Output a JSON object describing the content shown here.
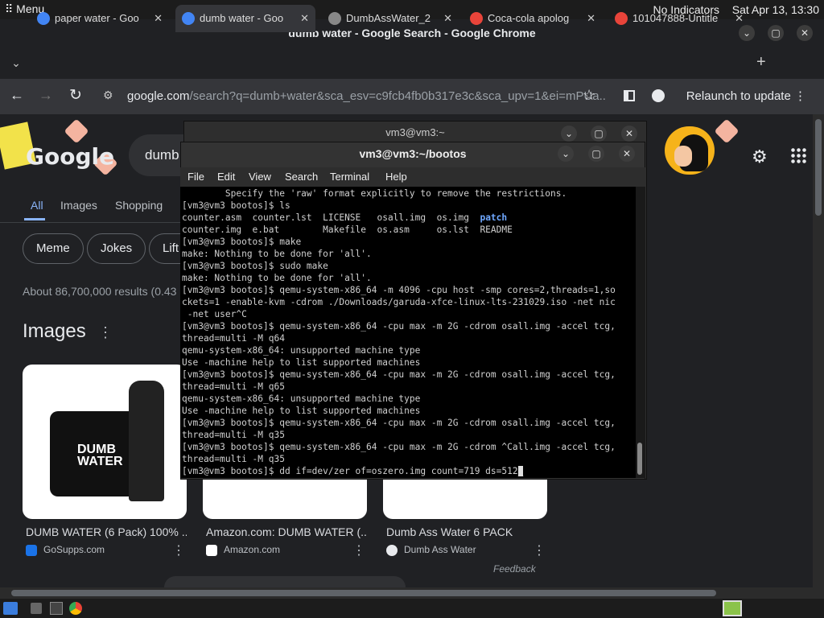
{
  "sysbar": {
    "menu": "Menu",
    "indicators": "No Indicators",
    "clock": "Sat Apr 13, 13:30"
  },
  "window": {
    "title": "dumb water - Google Search - Google Chrome",
    "minimize": "⌄",
    "maximize": "▢",
    "close": "✕"
  },
  "tabs": [
    {
      "label": "paper water - Goo",
      "close": "✕",
      "favicon_color": "#4285f4"
    },
    {
      "label": "dumb water - Goo",
      "close": "✕",
      "favicon_color": "#4285f4"
    },
    {
      "label": "DumbAssWater_2",
      "close": "✕",
      "favicon_color": "#888888"
    },
    {
      "label": "Coca-cola apolog",
      "close": "✕",
      "favicon_color": "#e8443a"
    },
    {
      "label": "101047888-Untitle",
      "close": "✕",
      "favicon_color": "#e8443a"
    }
  ],
  "new_tab": "+",
  "toolbar": {
    "back": "←",
    "forward": "→",
    "reload": "↻",
    "url_host": "google.com",
    "url_rest": "/search?q=dumb+water&sca_esv=c9fcb4fb0b317e3c&sca_upv=1&ei=mPUa...",
    "star": "☆",
    "relaunch": "Relaunch to update",
    "menu": "⋮"
  },
  "google": {
    "logo": "Google",
    "search_text": "dumb",
    "nav": [
      {
        "label": "All"
      },
      {
        "label": "Images"
      },
      {
        "label": "Shopping"
      }
    ],
    "chips": [
      {
        "label": "Meme"
      },
      {
        "label": "Jokes"
      },
      {
        "label": "Lift"
      }
    ],
    "results_count": "About 86,700,000 results (0.43",
    "images_heading": "Images",
    "images": [
      {
        "caption": "DUMB WATER (6 Pack) 100% ...",
        "source": "GoSupps.com",
        "product_text": "DUMB WATER"
      },
      {
        "caption": "Amazon.com: DUMB WATER (...",
        "source": "Amazon.com"
      },
      {
        "caption": "Dumb Ass Water 6 PACK",
        "source": "Dumb Ass Water"
      }
    ],
    "feedback": "Feedback",
    "more_menu": "⋮"
  },
  "terminal_outer": {
    "title": "vm3@vm3:~"
  },
  "terminal": {
    "title": "vm3@vm3:~/bootos",
    "menu": [
      {
        "label": "File"
      },
      {
        "label": "Edit"
      },
      {
        "label": "View"
      },
      {
        "label": "Search"
      },
      {
        "label": "Terminal"
      },
      {
        "label": "Help"
      }
    ],
    "lines": [
      "        Specify the 'raw' format explicitly to remove the restrictions.",
      "[vm3@vm3 bootos]$ ls",
      "counter.asm  counter.lst  LICENSE   osall.img  os.img  ",
      "counter.img  e.bat        Makefile  os.asm     os.lst  README",
      "[vm3@vm3 bootos]$ make",
      "make: Nothing to be done for 'all'.",
      "[vm3@vm3 bootos]$ sudo make",
      "make: Nothing to be done for 'all'.",
      "[vm3@vm3 bootos]$ qemu-system-x86_64 -m 4096 -cpu host -smp cores=2,threads=1,so",
      "ckets=1 -enable-kvm -cdrom ./Downloads/garuda-xfce-linux-lts-231029.iso -net nic",
      " -net user^C",
      "[vm3@vm3 bootos]$ qemu-system-x86_64 -cpu max -m 2G -cdrom osall.img -accel tcg,",
      "thread=multi -M q64",
      "qemu-system-x86_64: unsupported machine type",
      "Use -machine help to list supported machines",
      "[vm3@vm3 bootos]$ qemu-system-x86_64 -cpu max -m 2G -cdrom osall.img -accel tcg,",
      "thread=multi -M q65",
      "qemu-system-x86_64: unsupported machine type",
      "Use -machine help to list supported machines",
      "[vm3@vm3 bootos]$ qemu-system-x86_64 -cpu max -m 2G -cdrom osall.img -accel tcg,",
      "thread=multi -M q35",
      "[vm3@vm3 bootos]$ qemu-system-x86_64 -cpu max -m 2G -cdrom ^Call.img -accel tcg,",
      "thread=multi -M q35",
      "[vm3@vm3 bootos]$ dd if=dev/zer of=oszero.img count=719 ds=512"
    ],
    "patch_dir": "patch"
  }
}
